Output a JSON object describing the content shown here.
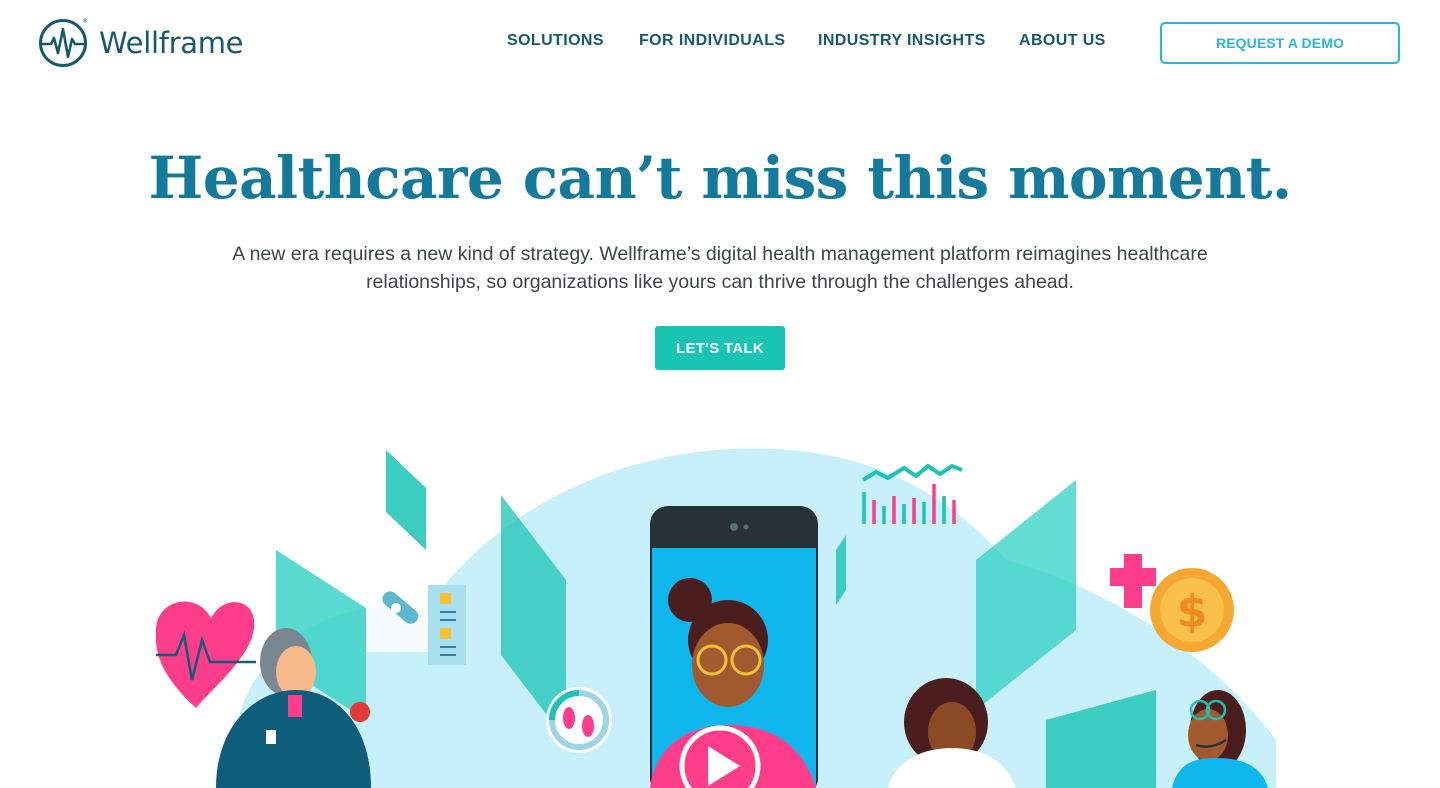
{
  "brand": {
    "name": "Wellframe",
    "registered_mark": "®",
    "logo_icon": "heartbeat-circle-icon",
    "color": "#16596d"
  },
  "nav": {
    "items": [
      {
        "label": "SOLUTIONS"
      },
      {
        "label": "FOR INDIVIDUALS"
      },
      {
        "label": "INDUSTRY INSIGHTS"
      },
      {
        "label": "ABOUT US"
      }
    ],
    "demo_button": "REQUEST A DEMO"
  },
  "hero": {
    "title": "Healthcare can’t miss this moment.",
    "subtitle_line1": "A new era requires a new kind of strategy. Wellframe’s digital health management platform reimagines healthcare",
    "subtitle_line2": "relationships, so organizations like yours can thrive through the challenges ahead.",
    "cta": "LET'S TALK"
  },
  "illustration": {
    "icons": [
      "heart-icon",
      "pill-icon",
      "checklist-icon",
      "footsteps-icon",
      "phone-icon",
      "play-icon",
      "trend-chart-icon",
      "plus-icon",
      "dollar-coin-icon",
      "headset-icon",
      "apple-icon"
    ],
    "colors": {
      "teal": "#19c4b4",
      "light_blue": "#c8f0fa",
      "pink": "#ff3d8b",
      "phone_blue": "#10b7ef",
      "coin": "#f7a830",
      "navy": "#0e5d7a"
    }
  },
  "colors": {
    "primary": "#137a9b",
    "cta": "#19c4b4",
    "demo_border": "#26b6e0",
    "text": "#3d4548"
  }
}
